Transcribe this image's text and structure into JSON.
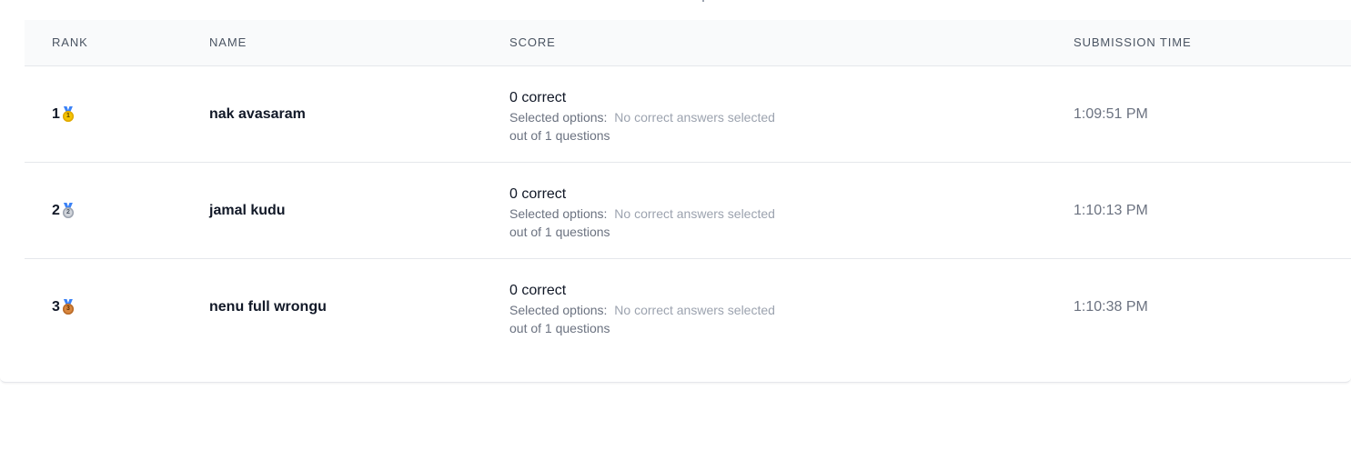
{
  "table": {
    "headers": {
      "rank": "RANK",
      "name": "NAME",
      "score": "SCORE",
      "time": "SUBMISSION TIME"
    },
    "rows": [
      {
        "rank": "1",
        "medal": "gold-medal-icon",
        "medal_number": "1",
        "name": "nak avasaram",
        "score": "0 correct",
        "selected_label": "Selected options:",
        "selected_value": "No correct answers selected",
        "out_of": "out of 1 questions",
        "time": "1:09:51 PM"
      },
      {
        "rank": "2",
        "medal": "silver-medal-icon",
        "medal_number": "2",
        "name": "jamal kudu",
        "score": "0 correct",
        "selected_label": "Selected options:",
        "selected_value": "No correct answers selected",
        "out_of": "out of 1 questions",
        "time": "1:10:13 PM"
      },
      {
        "rank": "3",
        "medal": "bronze-medal-icon",
        "medal_number": "3",
        "name": "nenu full wrongu",
        "score": "0 correct",
        "selected_label": "Selected options:",
        "selected_value": "No correct answers selected",
        "out_of": "out of 1 questions",
        "time": "1:10:38 PM"
      }
    ]
  },
  "colors": {
    "header_bg": "#f9fafb",
    "border": "#e5e7eb",
    "gold": "#f5c400",
    "silver": "#d1d5db",
    "bronze": "#d9873f",
    "ribbon": "#3b82f6"
  }
}
